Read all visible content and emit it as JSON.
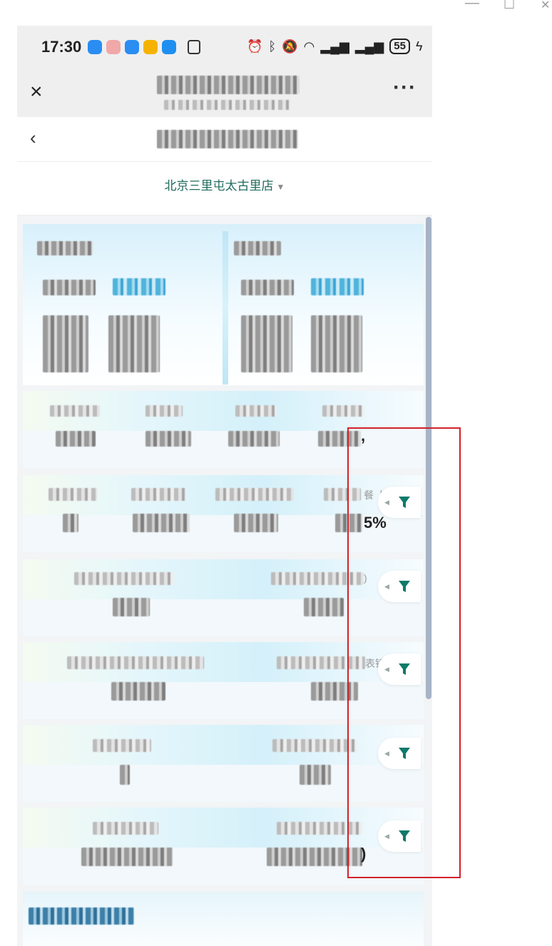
{
  "window_controls": {
    "minimize": "—",
    "maximize": "☐",
    "close": "✕"
  },
  "status_bar": {
    "time": "17:30",
    "app_icons": [
      "message-icon",
      "avatar-icon",
      "browser-icon",
      "weather-icon",
      "cloud-icon",
      "nfc-icon"
    ],
    "right_icons": [
      "alarm-icon",
      "bluetooth-icon",
      "mute-icon",
      "wifi-icon",
      "signal-icon",
      "signal-icon"
    ],
    "battery": "55"
  },
  "title_bar": {
    "close_glyph": "×",
    "more_glyph": "···"
  },
  "sub_bar": {
    "back_glyph": "‹"
  },
  "store_selector": {
    "label": "北京三里屯太古里店",
    "caret": "▼"
  },
  "visible_fragments": {
    "peek_1": "餐",
    "peek_2": "比",
    "peek_3": ")",
    "peek_4": "表镜",
    "comma": ",",
    "percent_tail": "5%",
    "bracket_tail": ")"
  },
  "colors": {
    "accent": "#1f6b5e",
    "filter": "#0f7a6a",
    "highlight_box": "#d2222a"
  }
}
